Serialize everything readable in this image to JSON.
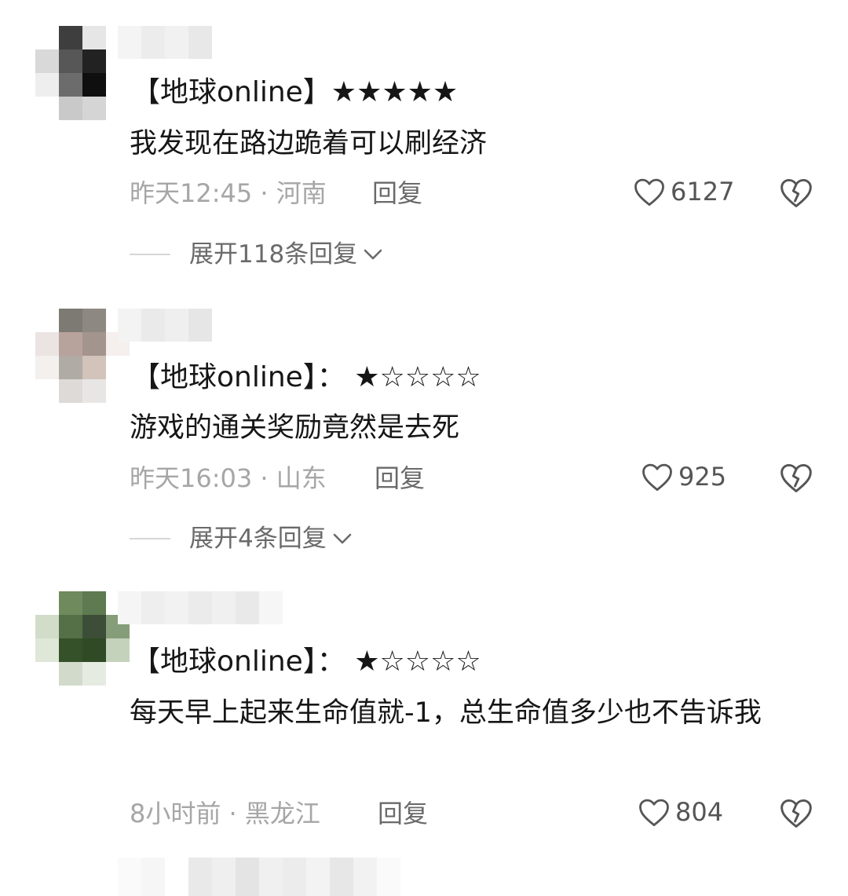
{
  "comments": [
    {
      "title": "【地球online】★★★★★",
      "body": "我发现在路边跪着可以刷经济",
      "meta": "昨天12:45 · 河南",
      "reply": "回复",
      "likes": "6127",
      "expand": "展开118条回复"
    },
    {
      "title": "【地球online】： ★☆☆☆☆",
      "body": "游戏的通关奖励竟然是去死",
      "meta": "昨天16:03 · 山东",
      "reply": "回复",
      "likes": "925",
      "expand": "展开4条回复"
    },
    {
      "title": "【地球online】： ★☆☆☆☆",
      "body": "每天早上起来生命值就-1，总生命值多少也不告诉我",
      "meta": "8小时前 · 黑龙江",
      "reply": "回复",
      "likes": "804"
    }
  ],
  "icons": {
    "like": "heart-outline-icon",
    "dislike": "broken-heart-icon",
    "expand": "chevron-down-icon"
  },
  "colors": {
    "text": "#161616",
    "meta": "#a6a6a6",
    "secondary": "#6a6a6a"
  }
}
